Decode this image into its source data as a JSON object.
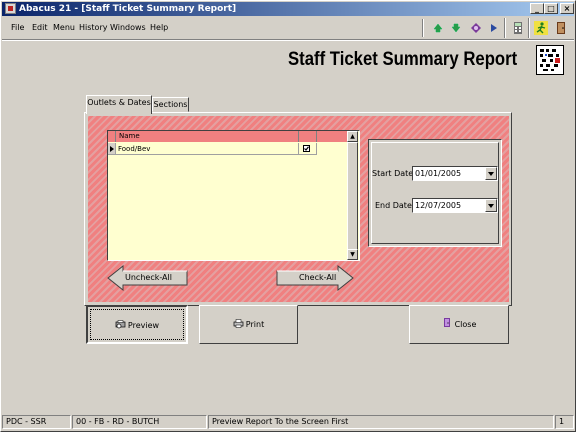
{
  "window": {
    "title": "Abacus 21 - [Staff Ticket Summary Report]",
    "minimize_glyph": "_",
    "maximize_glyph": "□",
    "close_glyph": "×"
  },
  "menu": {
    "items": [
      "File",
      "Edit",
      "Menu",
      "History",
      "Windows",
      "Help"
    ]
  },
  "toolbar": {
    "icons": [
      "arrow-green-up-icon",
      "arrow-green-down-icon",
      "diamond-icon",
      "record-nav-icon",
      "calculator-icon",
      "running-man-icon",
      "exit-door-icon"
    ]
  },
  "report": {
    "title": "Staff Ticket Summary Report"
  },
  "tabs": [
    {
      "label": "Outlets & Dates",
      "active": true
    },
    {
      "label": "Sections",
      "active": false
    }
  ],
  "grid": {
    "columns": [
      "Name",
      ""
    ],
    "rows": [
      {
        "name": "Food/Bev",
        "checked": true
      }
    ]
  },
  "buttons": {
    "uncheck_all": "Uncheck-All",
    "check_all": "Check-All",
    "preview": "Preview",
    "print": "Print",
    "close": "Close"
  },
  "dates": {
    "start_label": "Start Date",
    "start_value": "01/01/2005",
    "end_label": "End Date",
    "end_value": "12/07/2005"
  },
  "status": {
    "panel1": "PDC - SSR",
    "panel2": "00 - FB - RD - BUTCH",
    "panel3": "Preview Report To the Screen First",
    "panel4": "1"
  },
  "colors": {
    "title_bar_start": "#0a246a",
    "title_bar_end": "#a6caf0",
    "hatch_primary": "#f08080",
    "grid_background": "#ffffd0"
  }
}
